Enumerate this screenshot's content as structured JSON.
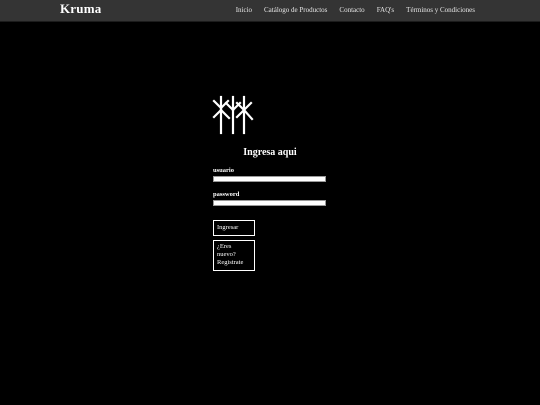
{
  "header": {
    "brand": "Kruma",
    "nav": [
      {
        "label": "Inicio"
      },
      {
        "label": "Catálogo de Productos"
      },
      {
        "label": "Contacto"
      },
      {
        "label": "FAQ's"
      },
      {
        "label": "Términos y Condiciones"
      }
    ]
  },
  "login": {
    "logo_icon": "kruma-rune-logo-icon",
    "title": "Ingresa aqui",
    "username_label": "usuario",
    "username_value": "",
    "password_label": "password",
    "password_value": "",
    "submit_label": "Ingresar",
    "register_label": "¿Eres nuevo? Registrate"
  },
  "colors": {
    "background": "#000000",
    "navbar": "#343434",
    "text": "#ffffff"
  }
}
